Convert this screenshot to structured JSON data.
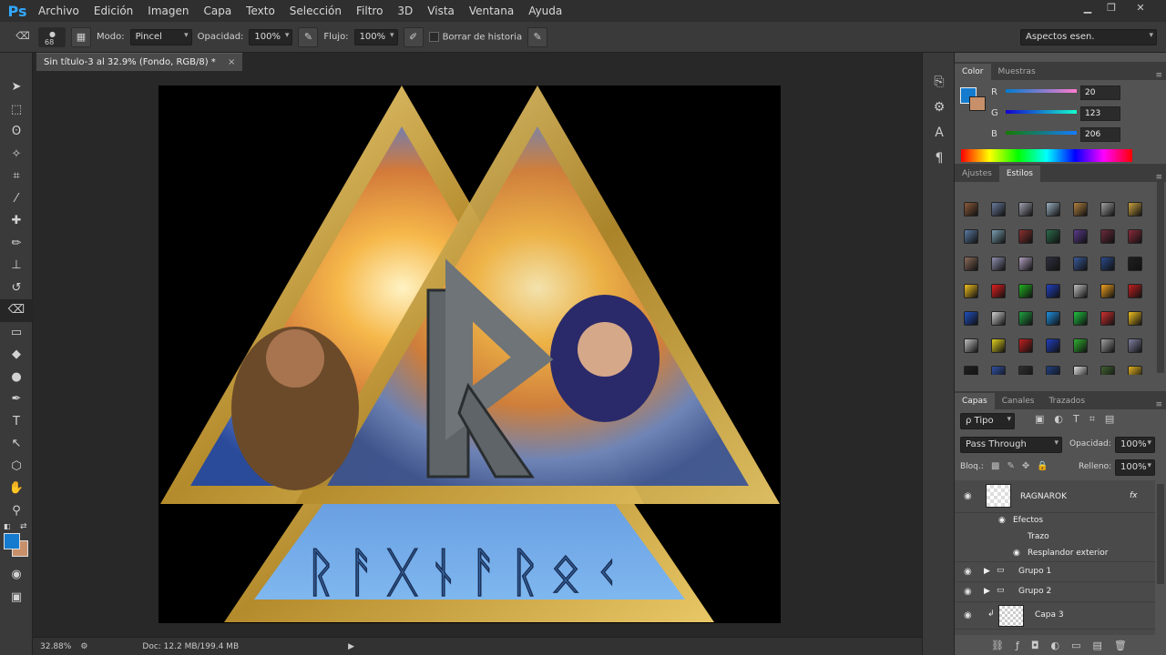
{
  "app": {
    "logo": "Ps"
  },
  "menu": [
    "Archivo",
    "Edición",
    "Imagen",
    "Capa",
    "Texto",
    "Selección",
    "Filtro",
    "3D",
    "Vista",
    "Ventana",
    "Ayuda"
  ],
  "options": {
    "brush_size": "68",
    "mode_label": "Modo:",
    "mode_value": "Pincel",
    "opacity_label": "Opacidad:",
    "opacity_value": "100%",
    "flow_label": "Flujo:",
    "flow_value": "100%",
    "history_label": "Borrar de historia",
    "workspace": "Aspectos esen."
  },
  "document": {
    "tab_title": "Sin título-3 al 32.9% (Fondo, RGB/8) *",
    "close": "×",
    "rune_text": "ᚱᚨᚷᚾᚨᚱᛟᚲ"
  },
  "status": {
    "zoom": "32.88%",
    "doc_info": "Doc: 12.2 MB/199.4 MB"
  },
  "color_panel": {
    "tabs": [
      "Color",
      "Muestras"
    ],
    "r_label": "R",
    "r_value": "20",
    "g_label": "G",
    "g_value": "123",
    "b_label": "B",
    "b_value": "206",
    "foreground": "#147bce",
    "background": "#c8906a"
  },
  "styles_panel": {
    "tabs": [
      "Ajustes",
      "Estilos"
    ]
  },
  "layers_panel": {
    "tabs": [
      "Capas",
      "Canales",
      "Trazados"
    ],
    "filter_label": "ρ Tipo",
    "blend_mode": "Pass Through",
    "opacity_label": "Opacidad:",
    "opacity_value": "100%",
    "lock_label": "Bloq.:",
    "fill_label": "Relleno:",
    "fill_value": "100%",
    "layers": [
      {
        "name": "RAGNAROK",
        "fx": "fx"
      },
      {
        "name": "Efectos"
      },
      {
        "name": "Trazo"
      },
      {
        "name": "Resplandor exterior"
      },
      {
        "name": "Grupo 1"
      },
      {
        "name": "Grupo 2"
      },
      {
        "name": "Capa 3"
      }
    ]
  }
}
